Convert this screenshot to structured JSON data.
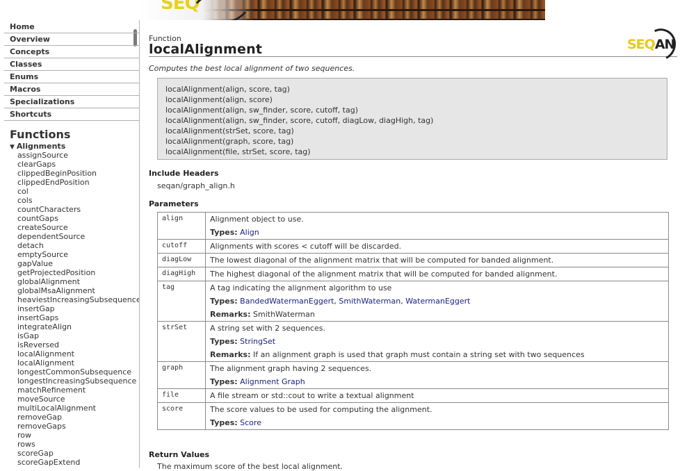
{
  "sidebar": {
    "nav": [
      "Home",
      "Overview",
      "Concepts",
      "Classes",
      "Enums",
      "Macros",
      "Specializations",
      "Shortcuts"
    ],
    "section_title": "Functions",
    "group": "Alignments",
    "functions": [
      "assignSource",
      "clearGaps",
      "clippedBeginPosition",
      "clippedEndPosition",
      "col",
      "cols",
      "countCharacters",
      "countGaps",
      "createSource",
      "dependentSource",
      "detach",
      "emptySource",
      "gapValue",
      "getProjectedPosition",
      "globalAlignment",
      "globalMsaAlignment",
      "heaviestIncreasingSubsequence",
      "insertGap",
      "insertGaps",
      "integrateAlign",
      "isGap",
      "isReversed",
      "localAlignment",
      "localAlignment",
      "longestCommonSubsequence",
      "longestIncreasingSubsequence",
      "matchRefinement",
      "moveSource",
      "multiLocalAlignment",
      "removeGap",
      "removeGaps",
      "row",
      "rows",
      "scoreGap",
      "scoreGapExtend"
    ]
  },
  "header": {
    "kind": "Function",
    "title": "localAlignment",
    "logo_text_a": "SEQ",
    "logo_text_b": "AN"
  },
  "brief": "Computes the best local alignment of two sequences.",
  "signatures": [
    "localAlignment(align, score, tag)",
    "localAlignment(align, score)",
    "localAlignment(align, sw_finder, score, cutoff, tag)",
    "localAlignment(align, sw_finder, score, cutoff, diagLow, diagHigh, tag)",
    "localAlignment(strSet, score, tag)",
    "localAlignment(graph, score, tag)",
    "localAlignment(file, strSet, score, tag)"
  ],
  "include": {
    "heading": "Include Headers",
    "value": "seqan/graph_align.h"
  },
  "params": {
    "heading": "Parameters",
    "types_label": "Types:",
    "remarks_label": "Remarks:",
    "rows": [
      {
        "name": "align",
        "desc": "Alignment object to use.",
        "types": [
          "Align"
        ],
        "remarks": ""
      },
      {
        "name": "cutoff",
        "desc": "Alignments with scores < cutoff will be discarded.",
        "types": [],
        "remarks": ""
      },
      {
        "name": "diagLow",
        "desc": "The lowest diagonal of the alignment matrix that will be computed for banded alignment.",
        "types": [],
        "remarks": ""
      },
      {
        "name": "diagHigh",
        "desc": "The highest diagonal of the alignment matrix that will be computed for banded alignment.",
        "types": [],
        "remarks": ""
      },
      {
        "name": "tag",
        "desc": "A tag indicating the alignment algorithm to use",
        "types": [
          "BandedWatermanEggert",
          "SmithWaterman",
          "WatermanEggert"
        ],
        "remarks": "SmithWaterman"
      },
      {
        "name": "strSet",
        "desc": "A string set with 2 sequences.",
        "types": [
          "StringSet"
        ],
        "remarks": "If an alignment graph is used that graph must contain a string set with two sequences"
      },
      {
        "name": "graph",
        "desc": "The alignment graph having 2 sequences.",
        "types": [
          "Alignment Graph"
        ],
        "remarks": ""
      },
      {
        "name": "file",
        "desc": "A file stream or std::cout to write a textual alignment",
        "types": [],
        "remarks": ""
      },
      {
        "name": "score",
        "desc": "The score values to be used for computing the alignment.",
        "types": [
          "Score"
        ],
        "remarks": ""
      }
    ]
  },
  "return": {
    "heading": "Return Values",
    "value": "The maximum score of the best local alignment."
  },
  "colors": {
    "link": "#1a237e",
    "sig_bg": "#e6e6e6",
    "logo_yellow": "#e8c91b"
  }
}
